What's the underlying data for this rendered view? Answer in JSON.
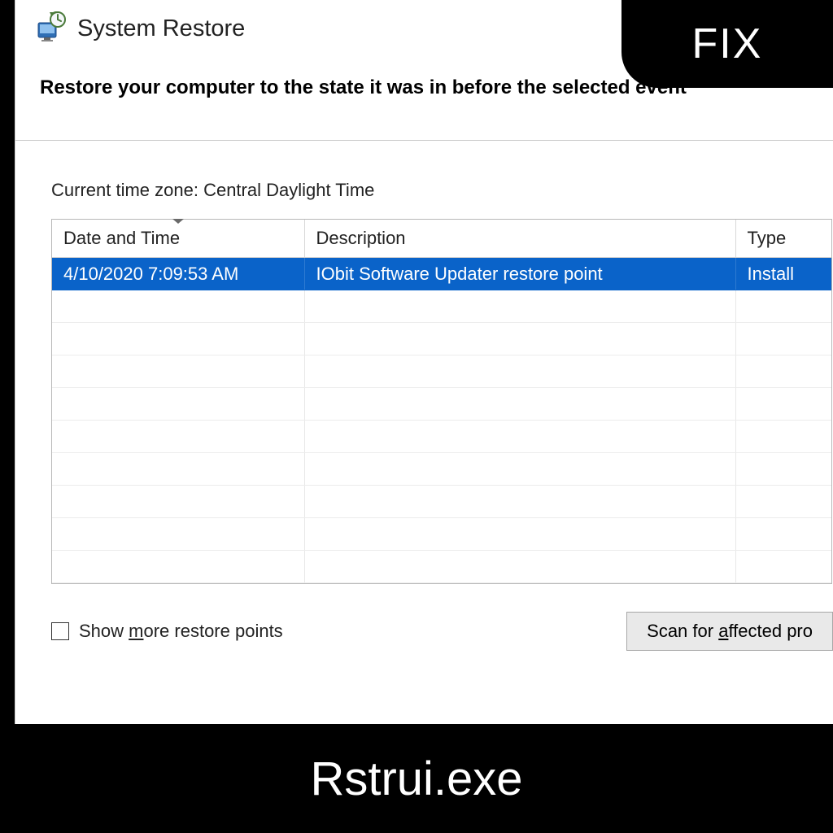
{
  "window": {
    "title": "System Restore",
    "heading": "Restore your computer to the state it was in before the selected event",
    "timezone_label": "Current time zone: Central Daylight Time"
  },
  "table": {
    "columns": {
      "date": "Date and Time",
      "description": "Description",
      "type": "Type"
    },
    "rows": [
      {
        "date": "4/10/2020 7:09:53 AM",
        "description": "IObit Software Updater restore point",
        "type": "Install",
        "selected": true
      }
    ],
    "empty_row_count": 9
  },
  "footer": {
    "checkbox_label_pre": "Show ",
    "checkbox_label_u": "m",
    "checkbox_label_post": "ore restore points",
    "scan_button_pre": "Scan for ",
    "scan_button_u": "a",
    "scan_button_post": "ffected pro"
  },
  "overlay": {
    "badge": "FIX",
    "caption": "Rstrui.exe"
  }
}
